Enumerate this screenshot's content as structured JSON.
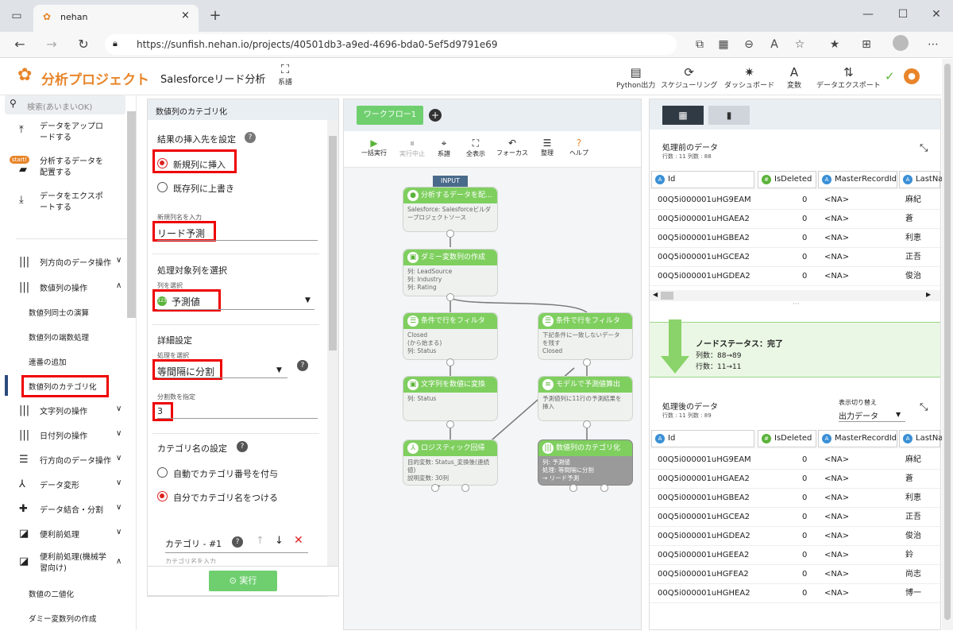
{
  "browser": {
    "tab_title": "nehan",
    "url": "https://sunfish.nehan.io/projects/40501db3-a9ed-4696-bda0-5ef5d9791e69"
  },
  "header": {
    "logo_text": "分析プロジェクト",
    "project_name": "Salesforceリード分析",
    "lineage_label": "系譜",
    "tools": [
      {
        "label": "Python出力",
        "icon": "file-icon"
      },
      {
        "label": "スケジューリング",
        "icon": "refresh-icon"
      },
      {
        "label": "ダッシュボード",
        "icon": "tree-icon"
      },
      {
        "label": "変数",
        "icon": "font-a-icon"
      },
      {
        "label": "データエクスポート",
        "icon": "sort-icon"
      }
    ]
  },
  "sidebar": {
    "search_placeholder": "検索(あいまいOK)",
    "top_items": [
      {
        "label": "データをアップロードする",
        "icon": "upload-icon"
      },
      {
        "label": "分析するデータを配置する",
        "icon": "start-icon",
        "badge": "start!"
      },
      {
        "label": "データをエクスポートする",
        "icon": "download-icon"
      }
    ],
    "categories": [
      {
        "label": "列方向のデータ操作",
        "chevron": "∨"
      },
      {
        "label": "数値列の操作",
        "chevron": "∧"
      },
      {
        "label": "文字列の操作",
        "chevron": "∨"
      },
      {
        "label": "日付列の操作",
        "chevron": "∨"
      },
      {
        "label": "行方向のデータ操作",
        "chevron": "∨"
      },
      {
        "label": "データ変形",
        "chevron": "∨"
      },
      {
        "label": "データ結合・分割",
        "chevron": "∨"
      },
      {
        "label": "便利前処理",
        "chevron": "∨"
      },
      {
        "label": "便利前処理(機械学習向け)",
        "chevron": "∧"
      }
    ],
    "subitems": [
      "数値列同士の演算",
      "数値列の端数処理",
      "連番の追加",
      "数値列のカテゴリ化"
    ],
    "ml_subitems": [
      "数値の二値化",
      "ダミー変数列の作成"
    ]
  },
  "panel": {
    "title": "数値列のカテゴリ化",
    "insert_heading": "結果の挿入先を設定",
    "insert_options": [
      "新規列に挿入",
      "既存列に上書き"
    ],
    "new_col_label": "新規列名を入力",
    "new_col_value": "リード予測",
    "target_heading": "処理対象列を選択",
    "target_label": "列を選択",
    "target_value": "予測値",
    "detail_heading": "詳細設定",
    "process_label": "処理を選択",
    "process_value": "等間隔に分割",
    "divisions_label": "分割数を指定",
    "divisions_value": "3",
    "catname_heading": "カテゴリ名の設定",
    "catname_options": [
      "自動でカテゴリ番号を付与",
      "自分でカテゴリ名をつける"
    ],
    "category_label": "カテゴリ - #1",
    "category_placeholder": "カテゴリ名を入力",
    "execute_label": "実行"
  },
  "workflow": {
    "tab_label": "ワークフロー1",
    "toolbar": [
      "一括実行",
      "実行中止",
      "系譜",
      "全表示",
      "フォーカス",
      "整理",
      "ヘルプ"
    ],
    "input_tag": "INPUT",
    "nodes": [
      {
        "title": "分析するデータを配...",
        "body": [
          "Salesforce: Salesforceビルダ",
          "ープロジェクトソース"
        ]
      },
      {
        "title": "ダミー変数列の作成",
        "body": [
          "列: LeadSource",
          "列: Industry",
          "列: Rating"
        ]
      },
      {
        "title": "条件で行をフィルタ",
        "body": [
          "Closed",
          "(から始まる)",
          "列: Status"
        ]
      },
      {
        "title": "条件で行をフィルタ",
        "body": [
          "下記条件に一致しないデータ",
          "を残す",
          "Closed"
        ]
      },
      {
        "title": "文字列を数値に変換",
        "body": [
          "列: Status"
        ]
      },
      {
        "title": "モデルで予測値算出",
        "body": [
          "予測値列に11行の予測結果を",
          "挿入"
        ]
      },
      {
        "title": "ロジスティック回帰",
        "body": [
          "目的変数: Status_変換後(連続",
          "値)",
          "説明変数: 30列"
        ]
      },
      {
        "title": "数値列のカテゴリ化",
        "body": [
          "列: 予測値",
          "処理: 等間隔に分割",
          "→ リード予測"
        ]
      }
    ]
  },
  "data_before": {
    "title": "処理前のデータ",
    "subtitle": "行数 : 11 列数 : 88",
    "columns": [
      "Id",
      "IsDeleted",
      "MasterRecordId",
      "LastNa"
    ],
    "rows": [
      [
        "00Q5i000001uHG9EAM",
        "0",
        "<NA>",
        "麻紀"
      ],
      [
        "00Q5i000001uHGAEA2",
        "0",
        "<NA>",
        "蒼"
      ],
      [
        "00Q5i000001uHGBEA2",
        "0",
        "<NA>",
        "利恵"
      ],
      [
        "00Q5i000001uHGCEA2",
        "0",
        "<NA>",
        "正吾"
      ],
      [
        "00Q5i000001uHGDEA2",
        "0",
        "<NA>",
        "俊治"
      ]
    ]
  },
  "node_status": {
    "title": "ノードステータス：完了",
    "cols": "列数：88→89",
    "rows": "行数：11→11"
  },
  "data_after": {
    "title": "処理後のデータ",
    "subtitle": "行数 : 11 列数 : 89",
    "toggle_label": "表示切り替え",
    "toggle_value": "出力データ",
    "columns": [
      "Id",
      "IsDeleted",
      "MasterRecordId",
      "LastNam"
    ],
    "rows": [
      [
        "00Q5i000001uHG9EAM",
        "0",
        "<NA>",
        "麻紀"
      ],
      [
        "00Q5i000001uHGAEA2",
        "0",
        "<NA>",
        "蒼"
      ],
      [
        "00Q5i000001uHGBEA2",
        "0",
        "<NA>",
        "利恵"
      ],
      [
        "00Q5i000001uHGCEA2",
        "0",
        "<NA>",
        "正吾"
      ],
      [
        "00Q5i000001uHGDEA2",
        "0",
        "<NA>",
        "俊治"
      ],
      [
        "00Q5i000001uHGEEA2",
        "0",
        "<NA>",
        "鈴"
      ],
      [
        "00Q5i000001uHGFEA2",
        "0",
        "<NA>",
        "尚志"
      ],
      [
        "00Q5i000001uHGHEA2",
        "0",
        "<NA>",
        "博一"
      ]
    ]
  },
  "colors": {
    "accent_green": "#7fcf5f",
    "brand_orange": "#e8852a",
    "highlight_red": "#ee0000"
  }
}
